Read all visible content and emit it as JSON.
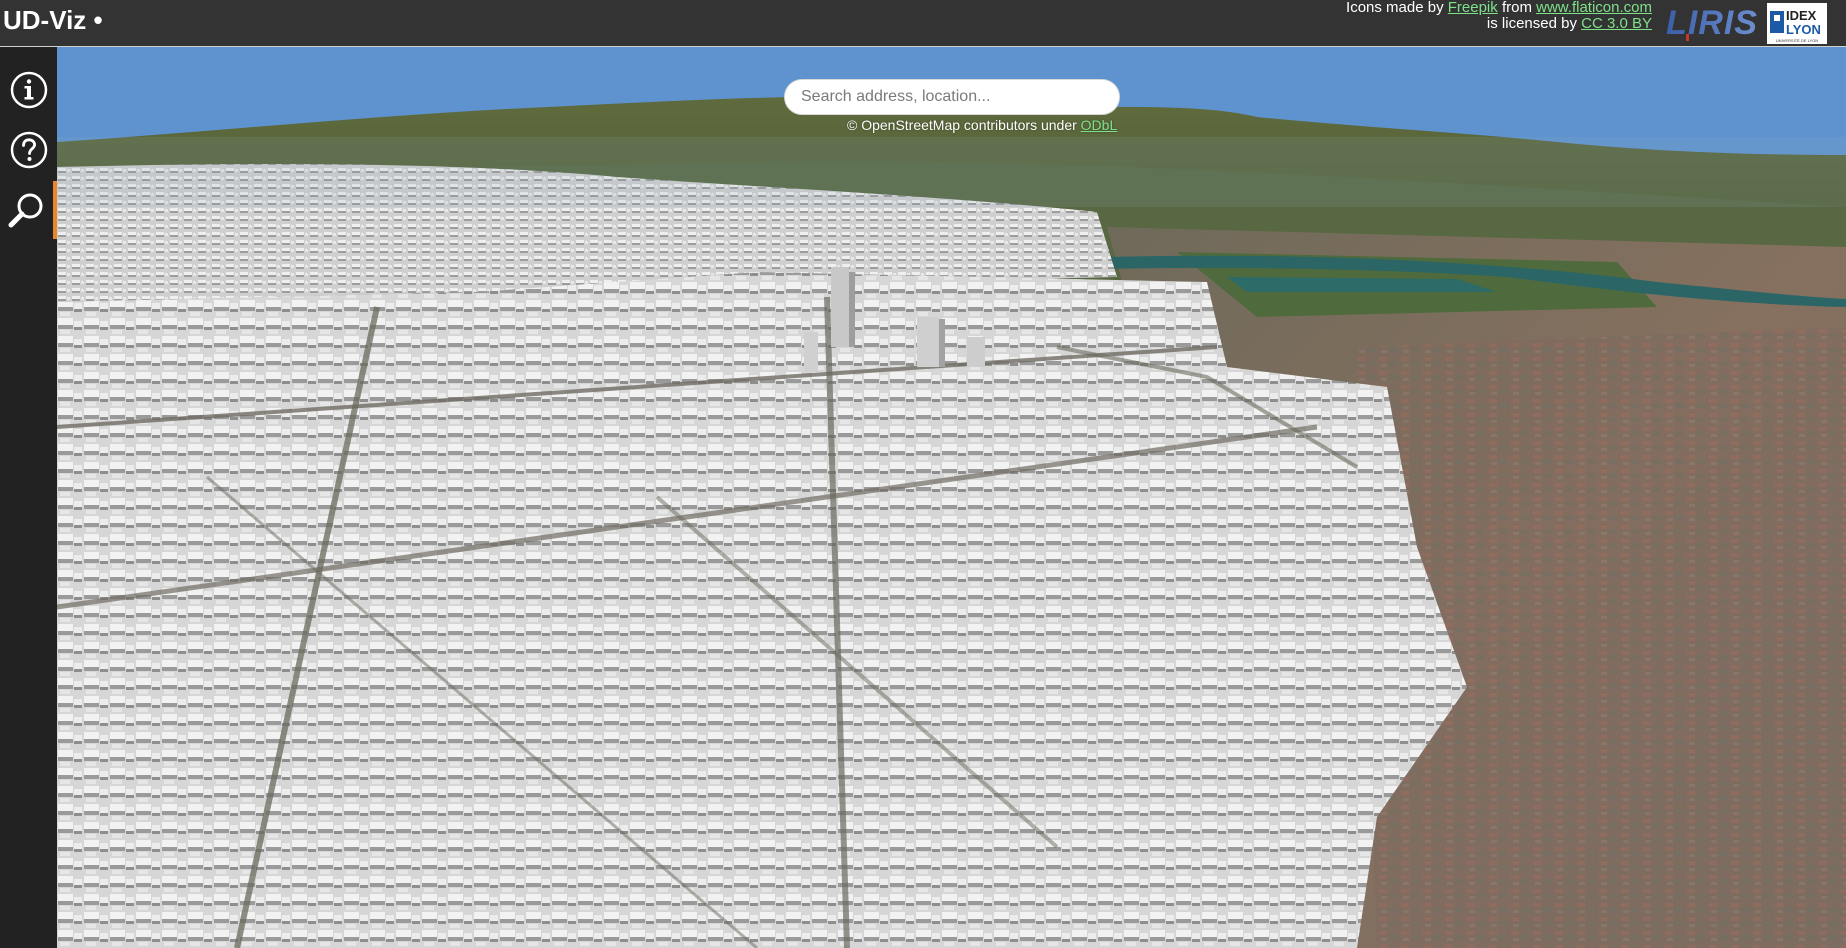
{
  "app": {
    "title": "UD-Viz •"
  },
  "credits": {
    "line1_prefix": "Icons made by ",
    "line1_author": "Freepik",
    "line1_mid": " from ",
    "line1_site": "www.flaticon.com",
    "line2_prefix": "is licensed by ",
    "line2_license": "CC 3.0 BY",
    "link_color": "#7fe08a"
  },
  "logos": {
    "liris": "LIRIS",
    "idex_line1": "IDEX",
    "idex_line2": "LYON",
    "idex_caption": "UNIVERSITÉ DE LYON"
  },
  "sidebar": {
    "items": [
      {
        "name": "info",
        "icon": "info-icon",
        "active": false
      },
      {
        "name": "help",
        "icon": "help-icon",
        "active": false
      },
      {
        "name": "search",
        "icon": "search-icon",
        "active": true
      }
    ],
    "active_color": "#e8882a"
  },
  "search": {
    "placeholder": "Search address, location...",
    "value": ""
  },
  "map": {
    "attribution_prefix": "© OpenStreetMap contributors under ",
    "attribution_license": "ODbL",
    "sky_color": "#5e93cf"
  }
}
